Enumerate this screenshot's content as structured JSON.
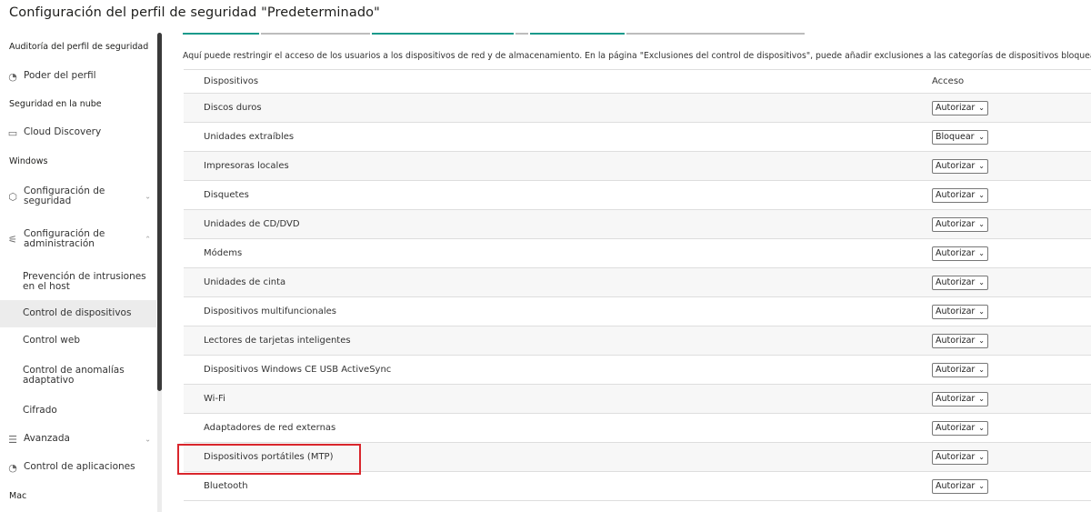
{
  "page": {
    "title": "Configuración del perfil de seguridad \"Predeterminado\""
  },
  "sidebar": {
    "items": [
      {
        "type": "section",
        "label": "Auditoría del perfil de seguridad"
      },
      {
        "type": "top",
        "label": "Poder del perfil",
        "icon": "profile-power-icon"
      },
      {
        "type": "section",
        "label": "Seguridad en la nube"
      },
      {
        "type": "top",
        "label": "Cloud Discovery",
        "icon": "monitor-icon"
      },
      {
        "type": "section",
        "label": "Windows"
      },
      {
        "type": "top",
        "label": "Configuración de seguridad",
        "icon": "shield-icon",
        "chevron": "down"
      },
      {
        "type": "top",
        "label": "Configuración de administración",
        "icon": "sliders-icon",
        "chevron": "up"
      },
      {
        "type": "sub",
        "label": "Prevención de intrusiones en el host"
      },
      {
        "type": "sub",
        "label": "Control de dispositivos",
        "active": true
      },
      {
        "type": "sub",
        "label": "Control web"
      },
      {
        "type": "sub",
        "label": "Control de anomalías adaptativo"
      },
      {
        "type": "sub",
        "label": "Cifrado"
      },
      {
        "type": "top",
        "label": "Avanzada",
        "icon": "list-icon",
        "chevron": "down"
      },
      {
        "type": "top",
        "label": "Control de aplicaciones",
        "icon": "app-control-icon"
      },
      {
        "type": "section",
        "label": "Mac"
      }
    ]
  },
  "main": {
    "description": "Aquí puede restringir el acceso de los usuarios a los dispositivos de red y de almacenamiento. En la página \"Exclusiones del control de dispositivos\", puede añadir exclusiones a las categorías de dispositivos bloquea",
    "table": {
      "headers": {
        "device": "Dispositivos",
        "access": "Acceso"
      },
      "rows": [
        {
          "device": "Discos duros",
          "access": "Autorizar"
        },
        {
          "device": "Unidades extraíbles",
          "access": "Bloquear"
        },
        {
          "device": "Impresoras locales",
          "access": "Autorizar"
        },
        {
          "device": "Disquetes",
          "access": "Autorizar"
        },
        {
          "device": "Unidades de CD/DVD",
          "access": "Autorizar"
        },
        {
          "device": "Módems",
          "access": "Autorizar"
        },
        {
          "device": "Unidades de cinta",
          "access": "Autorizar"
        },
        {
          "device": "Dispositivos multifuncionales",
          "access": "Autorizar"
        },
        {
          "device": "Lectores de tarjetas inteligentes",
          "access": "Autorizar"
        },
        {
          "device": "Dispositivos Windows CE USB ActiveSync",
          "access": "Autorizar"
        },
        {
          "device": "Wi-Fi",
          "access": "Autorizar"
        },
        {
          "device": "Adaptadores de red externas",
          "access": "Autorizar"
        },
        {
          "device": "Dispositivos portátiles (MTP)",
          "access": "Autorizar"
        },
        {
          "device": "Bluetooth",
          "access": "Autorizar"
        }
      ]
    }
  },
  "colors": {
    "highlight": "#d9262c",
    "link": "#1a9a8b"
  }
}
